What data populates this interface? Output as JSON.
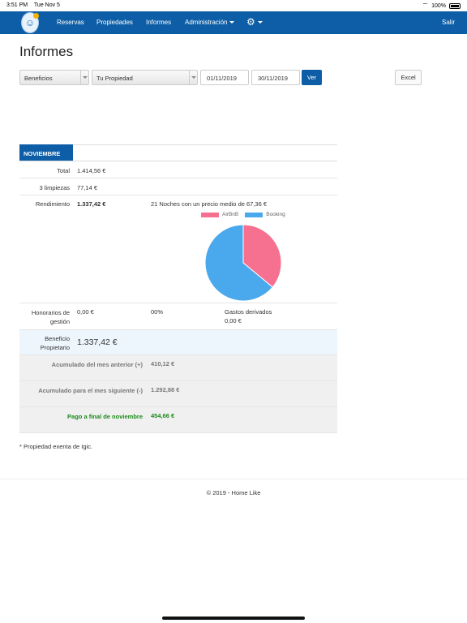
{
  "status_bar": {
    "time": "3:51 PM",
    "date": "Tue Nov 5",
    "battery": "100%"
  },
  "navbar": {
    "items": [
      "Reservas",
      "Propiedades",
      "Informes",
      "Administración"
    ],
    "logout": "Salir"
  },
  "page": {
    "title": "Informes"
  },
  "filters": {
    "report_type": "Beneficios",
    "property": "Tu Propiedad",
    "date_from": "01/11/2019",
    "date_to": "30/11/2019",
    "view_button": "Ver",
    "excel_button": "Excel"
  },
  "report": {
    "month": "NOVIEMBRE",
    "total": {
      "label": "Total",
      "value": "1.414,56 €"
    },
    "cleanings": {
      "label": "3 limpiezas",
      "value": "77,14 €"
    },
    "yield": {
      "label": "Rendimiento",
      "value": "1.337,42 €",
      "note": "21 Noches con un precio medio de 67,36 €"
    },
    "fees": {
      "label": "Honorarios de gestión",
      "value": "0,00 €",
      "percent": "00%",
      "expenses_label": "Gastos derivados",
      "expenses_value": "0,00 €"
    },
    "owner_profit": {
      "label": "Beneficio Propietario",
      "value": "1.337,42 €"
    },
    "prev_accumulated": {
      "label": "Acumulado del mes anterior (+)",
      "value": "410,12 €"
    },
    "next_accumulated": {
      "label": "Acumulado para el mes siguiente (-)",
      "value": "1.292,88 €"
    },
    "end_payment": {
      "label": "Pago a final de noviembre",
      "value": "454,66 €"
    }
  },
  "chart_data": {
    "type": "pie",
    "series": [
      {
        "name": "AirBnB",
        "value": 36,
        "color": "#f6708f"
      },
      {
        "name": "Booking",
        "value": 64,
        "color": "#4aa8ec"
      }
    ]
  },
  "footnote": "* Propiedad exenta de Igic.",
  "footer": "© 2019 - Home Like"
}
